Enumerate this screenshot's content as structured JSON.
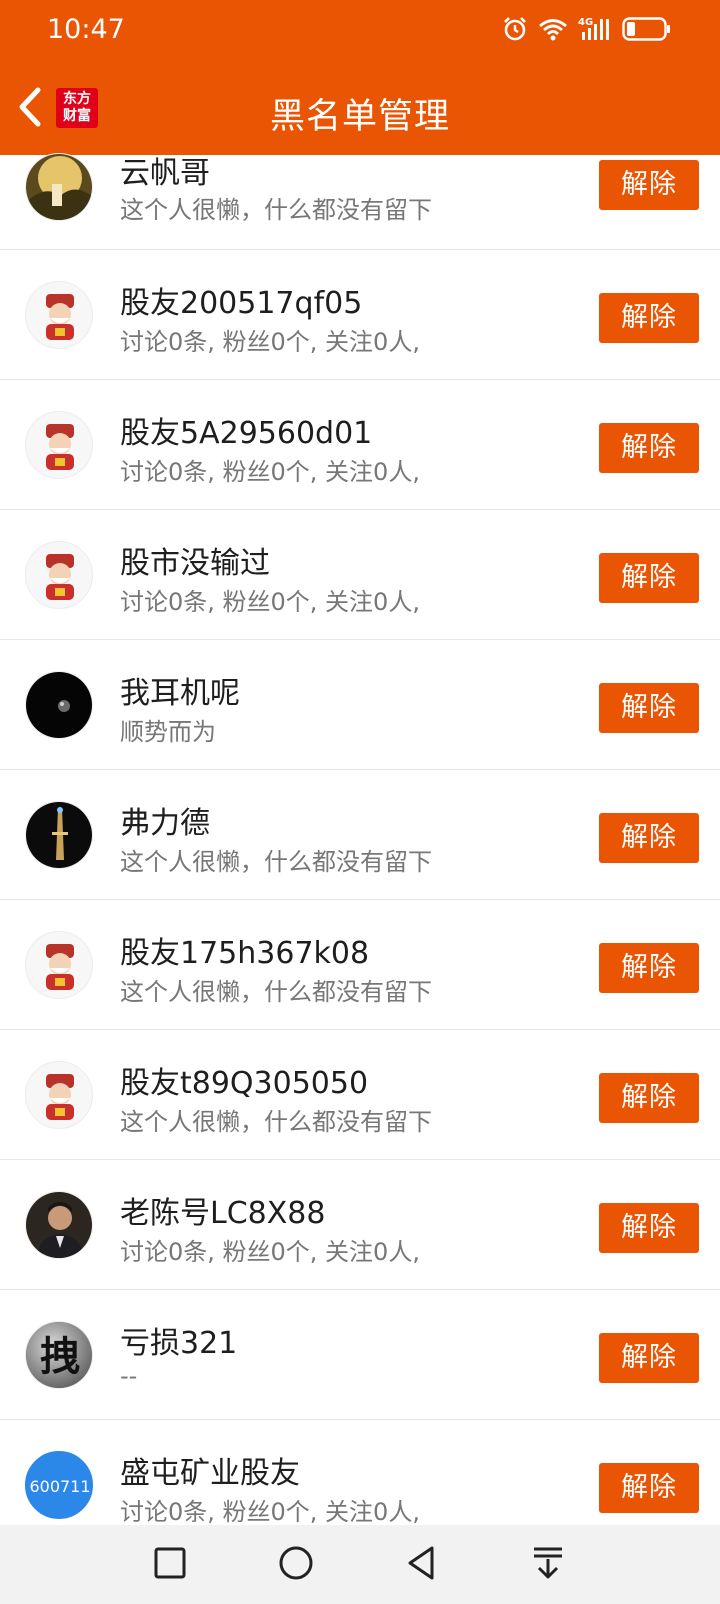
{
  "status_bar": {
    "time": "10:47",
    "icons": [
      "alarm-icon",
      "wifi-icon",
      "signal-4g-icon",
      "battery-icon"
    ]
  },
  "header": {
    "title": "黑名单管理",
    "logo_line1": "东方",
    "logo_line2": "财富",
    "accent_color": "#ea5504"
  },
  "list": {
    "unblock_label": "解除",
    "items": [
      {
        "name": "云帆哥",
        "desc": "这个人很懒，什么都没有留下",
        "avatar": "landscape"
      },
      {
        "name": "股友200517qf05",
        "desc": "讨论0条, 粉丝0个, 关注0人,",
        "avatar": "mascot"
      },
      {
        "name": "股友5A29560d01",
        "desc": "讨论0条, 粉丝0个, 关注0人,",
        "avatar": "mascot"
      },
      {
        "name": "股市没输过",
        "desc": "讨论0条, 粉丝0个, 关注0人,",
        "avatar": "mascot"
      },
      {
        "name": "我耳机呢",
        "desc": "顺势而为",
        "avatar": "dark-earth"
      },
      {
        "name": "弗力德",
        "desc": "这个人很懒，什么都没有留下",
        "avatar": "tower-night"
      },
      {
        "name": "股友175h367k08",
        "desc": "这个人很懒，什么都没有留下",
        "avatar": "mascot"
      },
      {
        "name": "股友t89Q305050",
        "desc": "这个人很懒，什么都没有留下",
        "avatar": "mascot"
      },
      {
        "name": "老陈号LC8X88",
        "desc": "讨论0条, 粉丝0个, 关注0人,",
        "avatar": "portrait"
      },
      {
        "name": "亏损321",
        "desc": "--",
        "avatar": "calligraphy",
        "avatar_text": "拽"
      },
      {
        "name": "盛屯矿业股友",
        "desc": "讨论0条, 粉丝0个, 关注0人,",
        "avatar": "stock-code",
        "avatar_text": "600711"
      }
    ]
  },
  "nav_bar": {
    "buttons": [
      "recent-apps-icon",
      "home-icon",
      "back-icon",
      "notification-pull-icon"
    ]
  }
}
